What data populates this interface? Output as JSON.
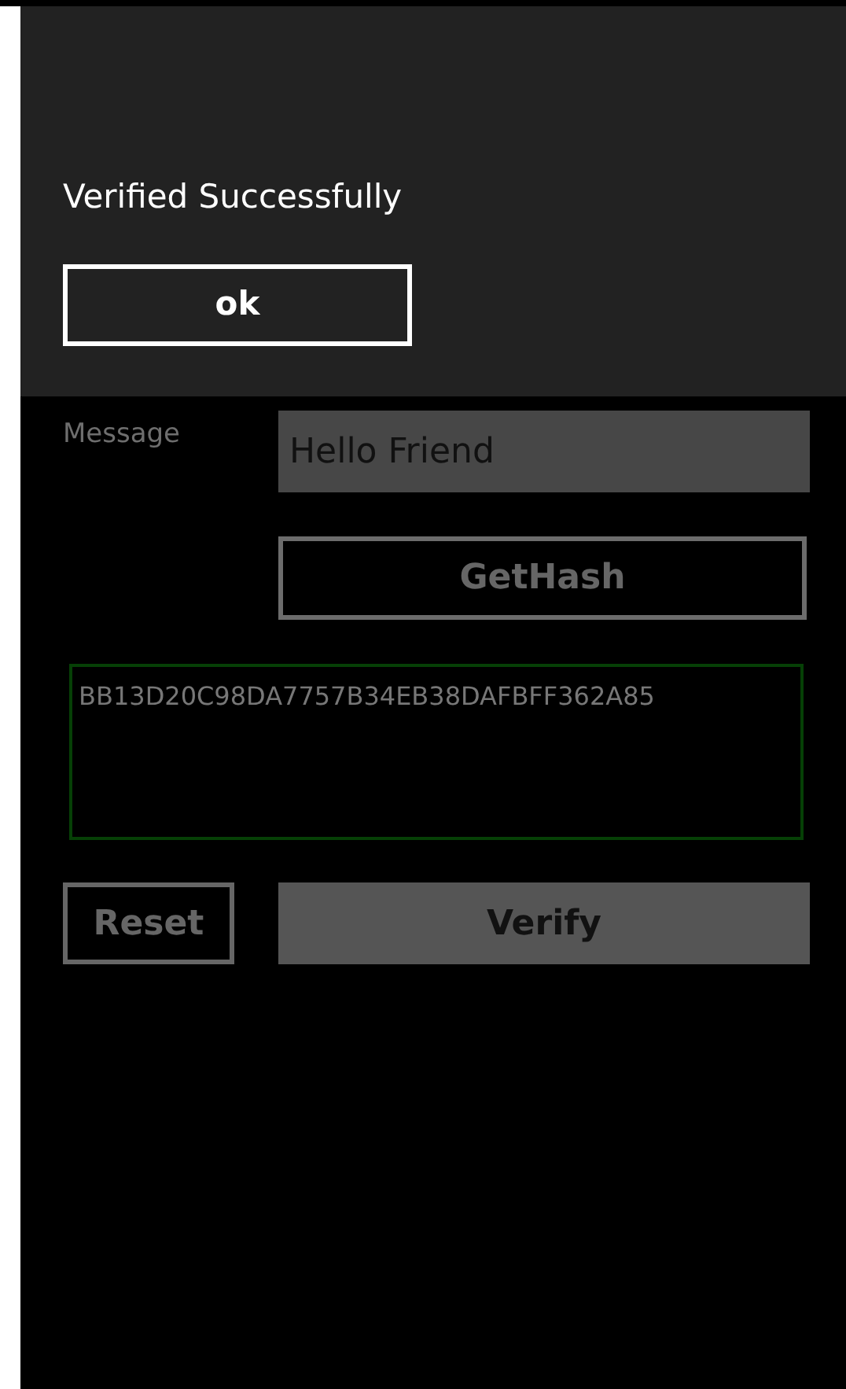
{
  "dialog": {
    "message": "Verified Successfully",
    "button": "ok"
  },
  "form": {
    "label": "Message",
    "value": "Hello Friend",
    "hash_button": "GetHash",
    "hash": "BB13D20C98DA7757B34EB38DAFBFF362A85",
    "reset_button": "Reset",
    "verify_button": "Verify"
  }
}
